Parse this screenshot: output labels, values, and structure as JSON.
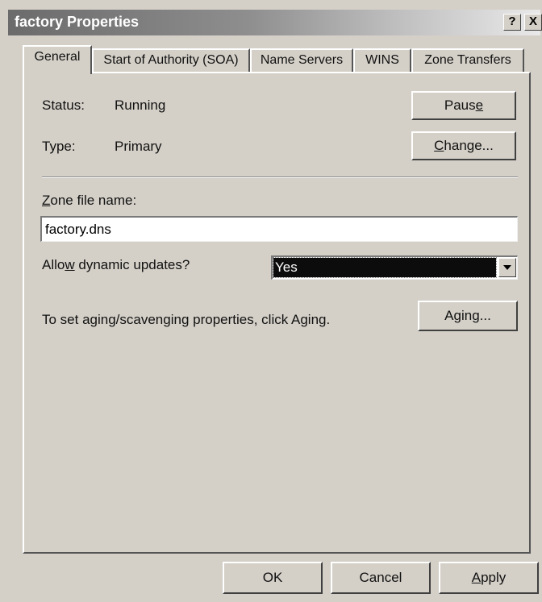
{
  "window": {
    "title": "factory Properties",
    "help_glyph": "?",
    "close_glyph": "X"
  },
  "tabs": [
    {
      "label": "General",
      "active": true
    },
    {
      "label": "Start of Authority (SOA)",
      "active": false
    },
    {
      "label": "Name Servers",
      "active": false
    },
    {
      "label": "WINS",
      "active": false
    },
    {
      "label": "Zone Transfers",
      "active": false
    }
  ],
  "general": {
    "status_label": "Status:",
    "status_value": "Running",
    "type_label": "Type:",
    "type_value": "Primary",
    "pause_button": {
      "before": "Paus",
      "accel": "e",
      "after": ""
    },
    "change_button": {
      "before": "",
      "accel": "C",
      "after": "hange..."
    },
    "zone_file_label": {
      "before": "",
      "accel": "Z",
      "after": "one file name:"
    },
    "zone_file_value": "factory.dns",
    "dynamic_updates_label": {
      "before": "Allo",
      "accel": "w",
      "after": " dynamic updates?"
    },
    "dynamic_updates_value": "Yes",
    "aging_text": "To set aging/scavenging properties, click Aging.",
    "aging_button": {
      "before": "A",
      "accel": "g",
      "after": "ing..."
    }
  },
  "footer": {
    "ok_label": "OK",
    "cancel_label": "Cancel",
    "apply_button": {
      "before": "",
      "accel": "A",
      "after": "pply"
    }
  }
}
